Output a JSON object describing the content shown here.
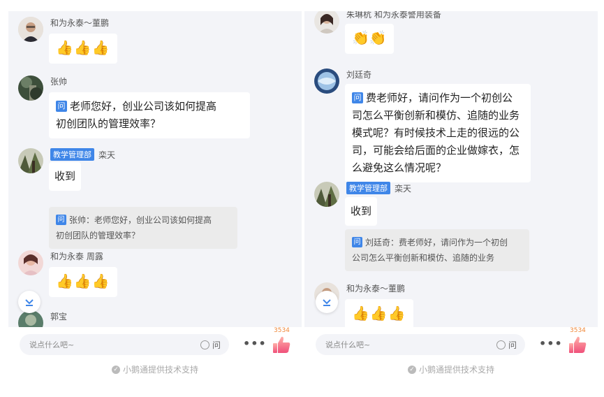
{
  "left": {
    "messages": [
      {
        "sender": "和为永泰～董鹏",
        "emoji": "👍👍👍"
      },
      {
        "sender": "张帅",
        "tag": "问",
        "text_line1": "老师您好，创业公司该如何提高",
        "text_line2": "初创团队的管理效率？"
      },
      {
        "role_badge": "教学管理部",
        "sender": "栾天",
        "reply": "收到",
        "quote_tag": "问",
        "quote_line1": "张帅：老师您好，创业公司该如何提高",
        "quote_line2": "初创团队的管理效率？"
      },
      {
        "sender": "和为永泰 周露",
        "emoji": "👍👍👍"
      },
      {
        "sender": "郭宝"
      }
    ]
  },
  "right": {
    "messages": [
      {
        "sender": "朱琳杭 和为永泰警用装备",
        "emoji": "👏👏"
      },
      {
        "sender": "刘廷奇",
        "tag": "问",
        "text_line1": "费老师好，请问作为一个初创公",
        "text_line2": "司怎么平衡创新和模仿、追随的业务",
        "text_line3": "模式呢？有时候技术上走的很远的公",
        "text_line4": "司，可能会给后面的企业做嫁衣，怎",
        "text_line5": "么避免这么情况呢？"
      },
      {
        "role_badge": "教学管理部",
        "sender": "栾天",
        "reply": "收到",
        "quote_tag": "问",
        "quote_line1": "刘廷奇：费老师好，请问作为一个初创",
        "quote_line2": "公司怎么平衡创新和模仿、追随的业务"
      },
      {
        "sender": "和为永泰～董鹏",
        "emoji": "👍👍👍"
      }
    ]
  },
  "input": {
    "placeholder": "说点什么吧~",
    "ask_label": "问",
    "more_label": "•••",
    "like_count": "3534"
  },
  "footer": {
    "text": "小鹅通提供技术支持"
  },
  "icons": {
    "scroll": "chevron-down-icon",
    "like": "thumbs-up-icon",
    "check": "check-circle-icon"
  },
  "colors": {
    "accent": "#3f86e8",
    "like": "#f08a3c",
    "background": "#f3f4f8"
  }
}
